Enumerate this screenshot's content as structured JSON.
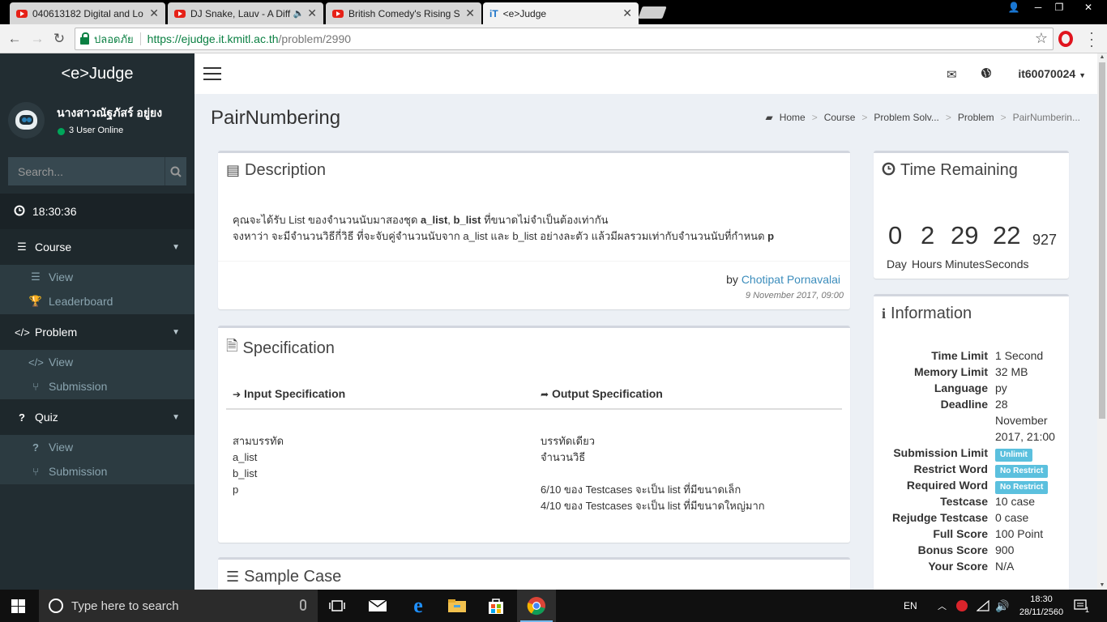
{
  "browser": {
    "tabs": [
      {
        "title": "040613182 Digital and Lo",
        "favicon": "youtube-icon",
        "audio": false,
        "active": false
      },
      {
        "title": "DJ Snake, Lauv - A Diff",
        "favicon": "youtube-icon",
        "audio": true,
        "active": false
      },
      {
        "title": "British Comedy's Rising S",
        "favicon": "youtube-icon",
        "audio": false,
        "active": false
      },
      {
        "title": "<e>Judge",
        "favicon": "it-icon",
        "audio": false,
        "active": true
      }
    ],
    "secure_label": "ปลอดภัย",
    "url_host": "https://ejudge.it.kmitl.ac.th",
    "url_path": "/problem/2990"
  },
  "sidebar": {
    "logo": "<e>Judge",
    "user_name": "นางสาวณัฐภัสร์ อยู่ยง",
    "online_text": "3 User Online",
    "search_placeholder": "Search...",
    "clock": "18:30:36",
    "course": {
      "label": "Course",
      "items": [
        "View",
        "Leaderboard"
      ]
    },
    "problem": {
      "label": "Problem",
      "items": [
        "View",
        "Submission"
      ]
    },
    "quiz": {
      "label": "Quiz",
      "items": [
        "View",
        "Submission"
      ]
    }
  },
  "topbar": {
    "username": "it60070024"
  },
  "header": {
    "title": "PairNumbering",
    "breadcrumb": [
      "Home",
      "Course",
      "Problem Solv...",
      "Problem",
      "PairNumberin..."
    ]
  },
  "description": {
    "title": "Description",
    "line1_a": "คุณจะได้รับ List ของจำนวนนับมาสองชุด ",
    "line1_b": "a_list",
    "line1_c": ", ",
    "line1_d": "b_list",
    "line1_e": " ที่ขนาดไม่จำเป็นต้องเท่ากัน",
    "line2_a": "จงหาว่า จะมีจำนวนวิธีกี่วิธี ที่จะจับคู่จำนวนนับจาก a_list และ b_list อย่างละตัว แล้วมีผลรวมเท่ากับจำนวนนับที่กำหนด ",
    "line2_b": "p",
    "by": "by",
    "author": "Chotipat Pornavalai",
    "date": "9 November 2017, 09:00"
  },
  "specification": {
    "title": "Specification",
    "input_title": "Input Specification",
    "output_title": "Output Specification",
    "input_lines": "สามบรรทัด\na_list\nb_list\np",
    "output_lines": "บรรทัดเดียว\nจำนวนวิธี\n\n6/10 ของ Testcases จะเป็น list ที่มีขนาดเล็ก\n4/10 ของ Testcases จะเป็น list ที่มีขนาดใหญ่มาก"
  },
  "sample": {
    "title": "Sample Case"
  },
  "time_remaining": {
    "title": "Time Remaining",
    "day": "0",
    "hours": "2",
    "minutes": "29",
    "seconds": "22",
    "ms": "927",
    "day_label": "Day",
    "hours_label": "Hours",
    "minutes_label": "Minutes",
    "seconds_label": "Seconds"
  },
  "information": {
    "title": "Information",
    "rows": [
      {
        "key": "Time Limit",
        "value": "1 Second"
      },
      {
        "key": "Memory Limit",
        "value": "32 MB"
      },
      {
        "key": "Language",
        "value": "py"
      },
      {
        "key": "Deadline",
        "value": "28 November 2017, 21:00"
      },
      {
        "key": "Submission Limit",
        "value": "Unlimit"
      },
      {
        "key": "Restrict Word",
        "value": "No Restrict"
      },
      {
        "key": "Required Word",
        "value": "No Restrict"
      },
      {
        "key": "Testcase",
        "value": "10 case"
      },
      {
        "key": "Rejudge Testcase",
        "value": "0 case"
      },
      {
        "key": "Full Score",
        "value": "100 Point"
      },
      {
        "key": "Bonus Score",
        "value": "900"
      },
      {
        "key": "Your Score",
        "value": "N/A"
      }
    ]
  },
  "taskbar": {
    "search_placeholder": "Type here to search",
    "lang": "EN",
    "time": "18:30",
    "date": "28/11/2560",
    "notification_count": "1"
  },
  "colors": {
    "sidebar_bg": "#222d32",
    "link": "#3c8dbc",
    "badge": "#5bc0de",
    "secure": "#0b8043"
  }
}
